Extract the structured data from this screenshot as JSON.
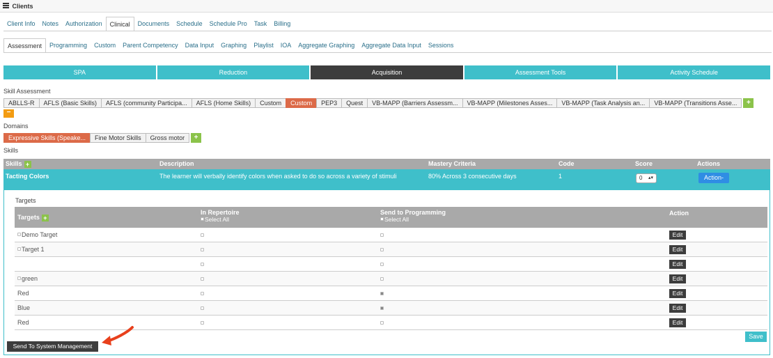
{
  "header": {
    "title": "Clients"
  },
  "main_tabs": [
    {
      "label": "Client Info",
      "active": false
    },
    {
      "label": "Notes",
      "active": false
    },
    {
      "label": "Authorization",
      "active": false
    },
    {
      "label": "Clinical",
      "active": true
    },
    {
      "label": "Documents",
      "active": false
    },
    {
      "label": "Schedule",
      "active": false
    },
    {
      "label": "Schedule Pro",
      "active": false
    },
    {
      "label": "Task",
      "active": false
    },
    {
      "label": "Billing",
      "active": false
    }
  ],
  "sub_tabs": [
    {
      "label": "Assessment",
      "active": true
    },
    {
      "label": "Programming",
      "active": false
    },
    {
      "label": "Custom",
      "active": false
    },
    {
      "label": "Parent Competency",
      "active": false
    },
    {
      "label": "Data Input",
      "active": false
    },
    {
      "label": "Graphing",
      "active": false
    },
    {
      "label": "Playlist",
      "active": false
    },
    {
      "label": "IOA",
      "active": false
    },
    {
      "label": "Aggregate Graphing",
      "active": false
    },
    {
      "label": "Aggregate Data Input",
      "active": false
    },
    {
      "label": "Sessions",
      "active": false
    }
  ],
  "sections": [
    {
      "label": "SPA",
      "active": false
    },
    {
      "label": "Reduction",
      "active": false
    },
    {
      "label": "Acquisition",
      "active": true
    },
    {
      "label": "Assessment Tools",
      "active": false
    },
    {
      "label": "Activity Schedule",
      "active": false
    }
  ],
  "skill_assessment": {
    "label": "Skill Assessment",
    "items": [
      {
        "label": "ABLLS-R",
        "active": false
      },
      {
        "label": "AFLS (Basic Skills)",
        "active": false
      },
      {
        "label": "AFLS (community Participa...",
        "active": false
      },
      {
        "label": "AFLS (Home Skills)",
        "active": false
      },
      {
        "label": "Custom",
        "active": false
      },
      {
        "label": "Custom",
        "active": true
      },
      {
        "label": "PEP3",
        "active": false
      },
      {
        "label": "Quest",
        "active": false
      },
      {
        "label": "VB-MAPP (Barriers Assessm...",
        "active": false
      },
      {
        "label": "VB-MAPP (Milestones Asses...",
        "active": false
      },
      {
        "label": "VB-MAPP (Task Analysis an...",
        "active": false
      },
      {
        "label": "VB-MAPP (Transitions Asse...",
        "active": false
      }
    ],
    "add_symbol": "+",
    "remove_symbol": "−"
  },
  "domains": {
    "label": "Domains",
    "items": [
      {
        "label": "Expressive Skills (Speake...",
        "active": true
      },
      {
        "label": "Fine Motor Skills",
        "active": false
      },
      {
        "label": "Gross motor",
        "active": false
      }
    ],
    "add_symbol": "+"
  },
  "skills": {
    "label": "Skills",
    "columns": {
      "skills": "Skills",
      "description": "Description",
      "mastery": "Mastery Criteria",
      "code": "Code",
      "score": "Score",
      "actions": "Actions"
    },
    "row": {
      "name": "Tacting Colors",
      "description": "The learner will verbally identify colors when asked to do so across a variety of stimuli",
      "mastery": "80% Across 3 consecutive days",
      "code": "1",
      "score": "0",
      "action_label": "Action-"
    }
  },
  "targets": {
    "label": "Targets",
    "columns": {
      "targets": "Targets",
      "in_repertoire": "In Repertoire",
      "send_to_programming": "Send to Programming",
      "select_all": "Select All",
      "action": "Action"
    },
    "rows": [
      {
        "name": "Demo Target",
        "has_checkbox": true,
        "in_repertoire": false,
        "send": false
      },
      {
        "name": "Target 1",
        "has_checkbox": true,
        "in_repertoire": false,
        "send": false
      },
      {
        "name": "",
        "has_checkbox": false,
        "in_repertoire": false,
        "send": false
      },
      {
        "name": "green",
        "has_checkbox": true,
        "in_repertoire": false,
        "send": false
      },
      {
        "name": "Red",
        "has_checkbox": false,
        "in_repertoire": false,
        "send": true
      },
      {
        "name": "Blue",
        "has_checkbox": false,
        "in_repertoire": false,
        "send": true
      },
      {
        "name": "Red",
        "has_checkbox": false,
        "in_repertoire": false,
        "send": false
      }
    ],
    "edit_label": "Edit",
    "save_label": "Save"
  },
  "send_to_system_label": "Send To System Management",
  "colors": {
    "teal": "#3fbfca",
    "dark": "#3d3d3d",
    "orange": "#dc6a48",
    "green_add": "#8bc34a",
    "annotation_arrow": "#e8401c"
  }
}
